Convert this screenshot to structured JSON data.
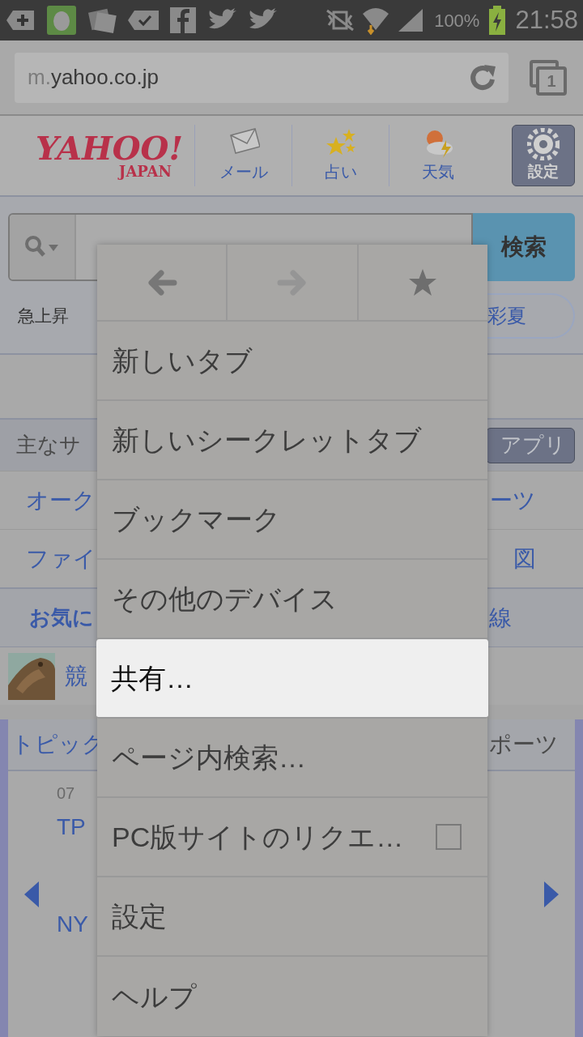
{
  "status_bar": {
    "battery": "100%",
    "time": "21:58"
  },
  "address_bar": {
    "domain_prefix": "m.",
    "domain": "yahoo.co.jp",
    "tab_count": "1"
  },
  "header": {
    "logo": "YAHOO!",
    "logo_sub": "JAPAN",
    "nav": [
      {
        "label": "メール",
        "kind": "mail"
      },
      {
        "label": "占い",
        "kind": "stars"
      },
      {
        "label": "天気",
        "kind": "weather"
      },
      {
        "label": "設定",
        "kind": "settings"
      }
    ]
  },
  "search": {
    "button": "検索",
    "trending_label": "急上昇",
    "trending_right": "彩夏"
  },
  "services": {
    "title": "主なサ",
    "apps_button": "アプリ",
    "rows": [
      {
        "left": "オーク",
        "right": "ーツ"
      },
      {
        "left": "ファイ",
        "right": "図"
      }
    ]
  },
  "favorites": {
    "left": "お気に",
    "right": "線"
  },
  "keiba": {
    "label": "競"
  },
  "topics": {
    "left": "トピック",
    "right": "ポーツ",
    "time": "07",
    "lines": [
      "TP",
      "NY"
    ]
  },
  "menu": {
    "nav": [
      {
        "kind": "back",
        "disabled": false
      },
      {
        "kind": "forward",
        "disabled": true
      },
      {
        "kind": "bookmark",
        "disabled": false
      }
    ],
    "items": [
      {
        "label": "新しいタブ",
        "selected": false
      },
      {
        "label": "新しいシークレットタブ",
        "selected": false
      },
      {
        "label": "ブックマーク",
        "selected": false
      },
      {
        "label": "その他のデバイス",
        "selected": false
      },
      {
        "label": "共有…",
        "selected": true
      },
      {
        "label": "ページ内検索…",
        "selected": false
      },
      {
        "label": "PC版サイトのリクエ…",
        "selected": false,
        "kind": "checkbox",
        "checked": false
      },
      {
        "label": "設定",
        "selected": false
      },
      {
        "label": "ヘルプ",
        "selected": false
      }
    ]
  }
}
